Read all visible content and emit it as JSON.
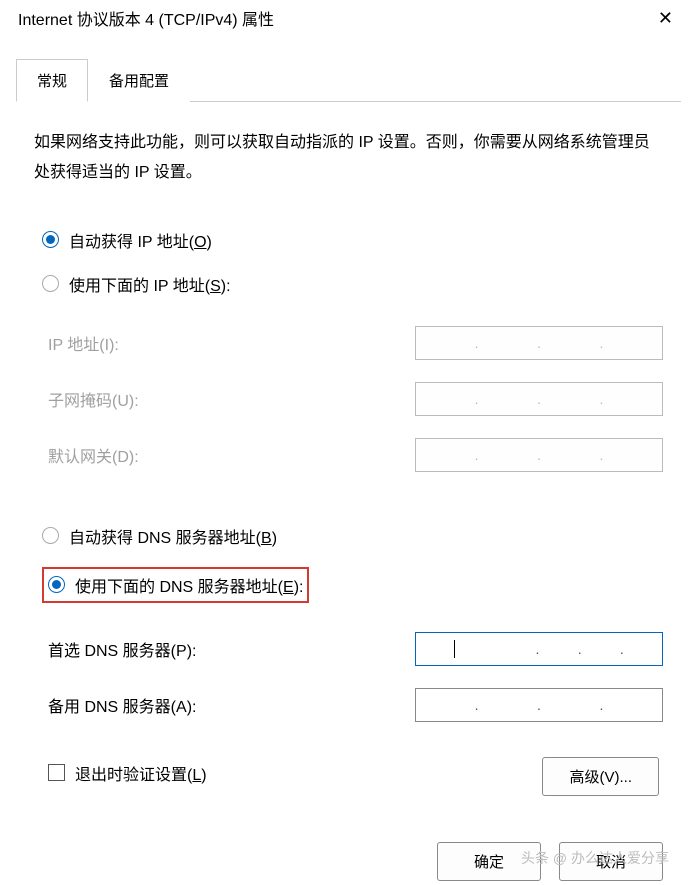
{
  "window": {
    "title": "Internet 协议版本 4 (TCP/IPv4) 属性",
    "close_icon": "✕"
  },
  "tabs": {
    "general": "常规",
    "alternate": "备用配置"
  },
  "description": "如果网络支持此功能，则可以获取自动指派的 IP 设置。否则，你需要从网络系统管理员处获得适当的 IP 设置。",
  "ip_section": {
    "auto_label_prefix": "自动获得 IP 地址(",
    "auto_key": "O",
    "auto_label_suffix": ")",
    "manual_label_prefix": "使用下面的 IP 地址(",
    "manual_key": "S",
    "manual_label_suffix": "):",
    "fields": {
      "ip_label_prefix": "IP 地址(",
      "ip_key": "I",
      "ip_label_suffix": "):",
      "mask_label_prefix": "子网掩码(",
      "mask_key": "U",
      "mask_label_suffix": "):",
      "gateway_label_prefix": "默认网关(",
      "gateway_key": "D",
      "gateway_label_suffix": "):"
    }
  },
  "dns_section": {
    "auto_label_prefix": "自动获得 DNS 服务器地址(",
    "auto_key": "B",
    "auto_label_suffix": ")",
    "manual_label_prefix": "使用下面的 DNS 服务器地址(",
    "manual_key": "E",
    "manual_label_suffix": "):",
    "fields": {
      "pref_label_prefix": "首选 DNS 服务器(",
      "pref_key": "P",
      "pref_label_suffix": "):",
      "alt_label_prefix": "备用 DNS 服务器(",
      "alt_key": "A",
      "alt_label_suffix": "):"
    }
  },
  "validate": {
    "label_prefix": "退出时验证设置(",
    "key": "L",
    "label_suffix": ")"
  },
  "buttons": {
    "advanced_prefix": "高级(",
    "advanced_key": "V",
    "advanced_suffix": ")...",
    "ok": "确定",
    "cancel": "取消"
  },
  "watermark": "头条 @ 办么达人爱分享"
}
